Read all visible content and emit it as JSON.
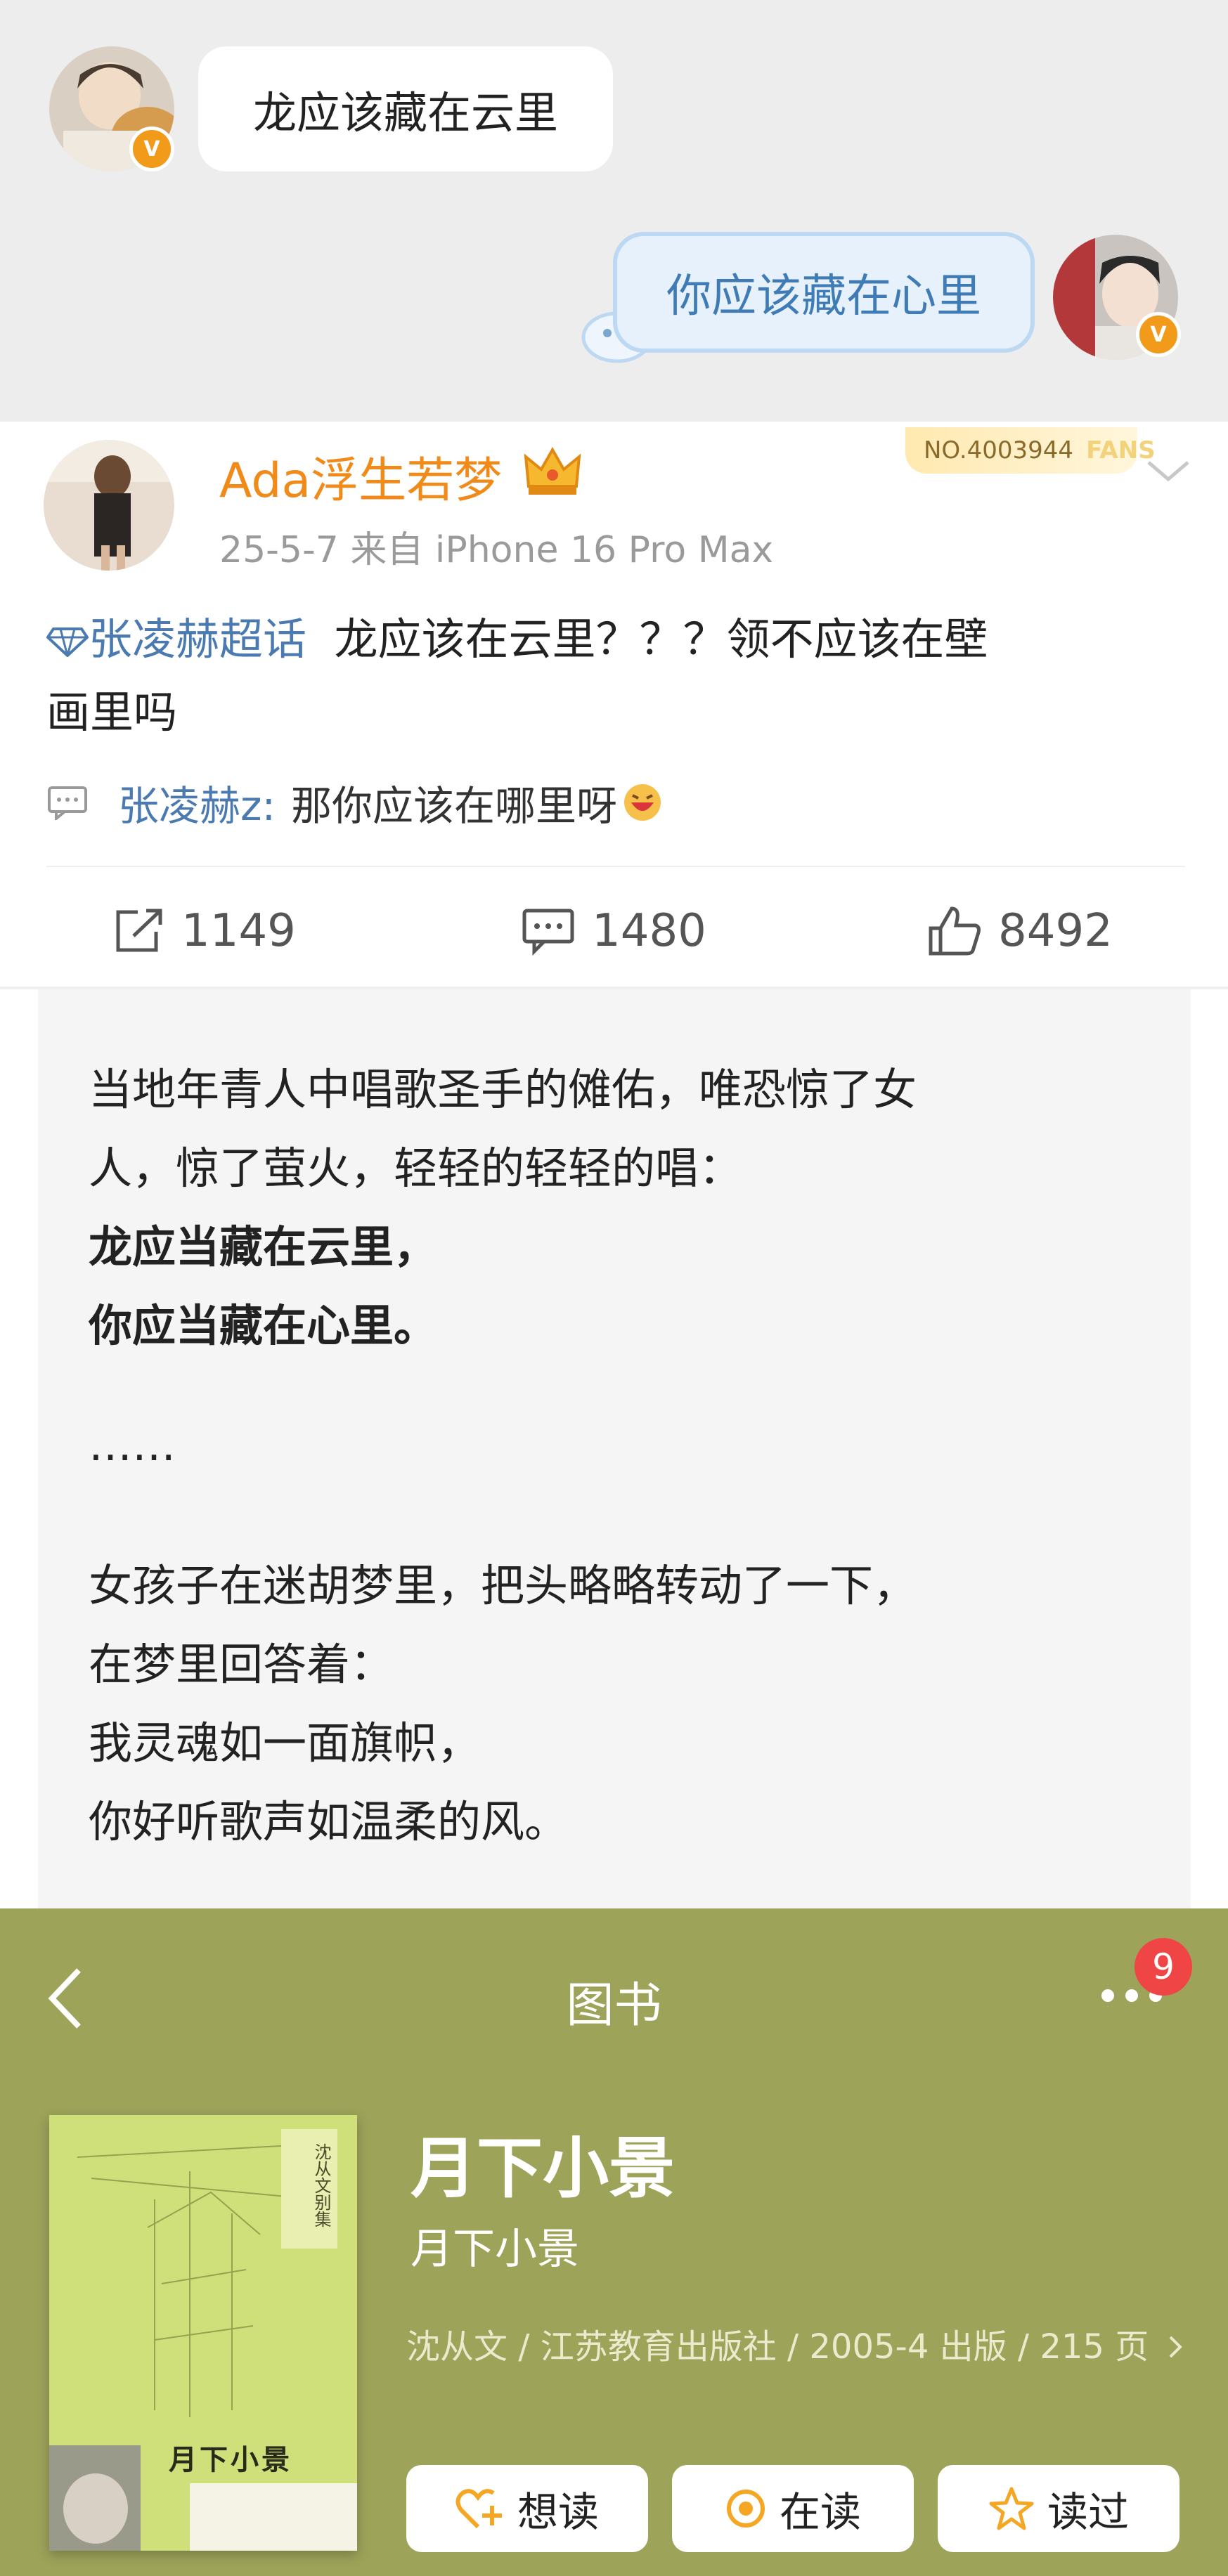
{
  "chat": {
    "left_message": "龙应该藏在云里",
    "right_message": "你应该藏在心里"
  },
  "post": {
    "username": "Ada浮生若梦",
    "meta": "25-5-7  来自 iPhone 16 Pro Max",
    "fans_badge": "NO.4003944",
    "fans_badge_watermark": "FANS",
    "topic": "张凌赫超话",
    "text_line1": "龙应该在云里？？？领不应该在壁",
    "text_line2": "画里吗",
    "comment_user": "张凌赫z:",
    "comment_text": "那你应该在哪里呀",
    "reposts": "1149",
    "comments": "1480",
    "likes": "8492"
  },
  "excerpt": {
    "lines": [
      "当地年青人中唱歌圣手的傩佑，唯恐惊了女",
      "人，惊了萤火，轻轻的轻轻的唱：",
      "龙应当藏在云里，",
      "你应当藏在心里。",
      "……",
      "女孩子在迷胡梦里，把头略略转动了一下，",
      "在梦里回答着：",
      "我灵魂如一面旗帜，",
      "你好听歌声如温柔的风。"
    ]
  },
  "book": {
    "header_title": "图书",
    "notification_count": "9",
    "title": "月下小景",
    "subtitle": "月下小景",
    "meta": "沈从文 / 江苏教育出版社 / 2005-4 出版 / 215 页",
    "cover_title": "月下小景",
    "cover_series": "沈从文别集",
    "buttons": {
      "want": "想读",
      "reading": "在读",
      "read": "读过"
    }
  },
  "colors": {
    "username": "#f08a19",
    "link": "#4a7ab0",
    "book_panel": "#9ea35a",
    "chat_background": "#ededed"
  }
}
